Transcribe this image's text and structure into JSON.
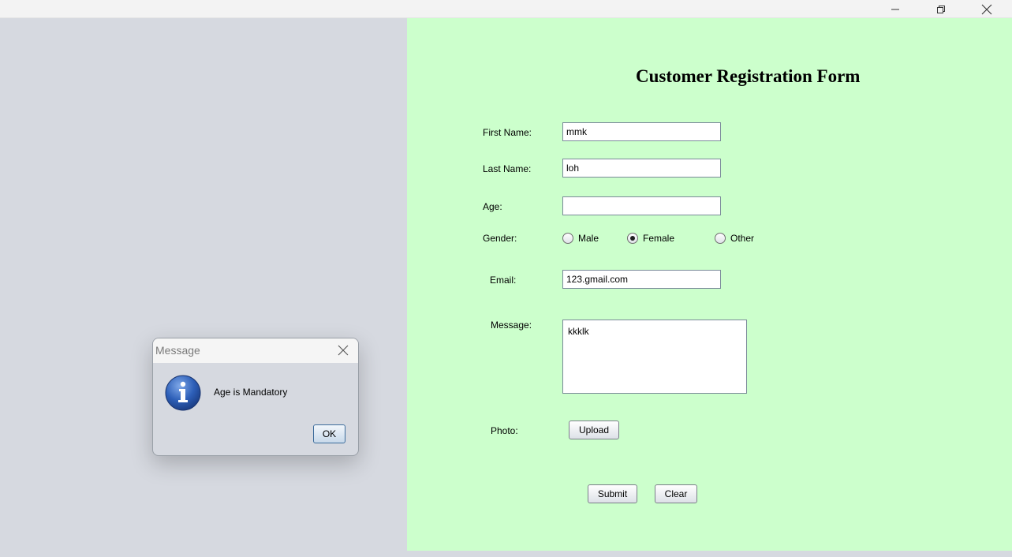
{
  "window": {
    "minimize_icon": "minimize-icon",
    "restore_icon": "restore-icon",
    "close_icon": "close-icon"
  },
  "form": {
    "title": "Customer Registration Form",
    "first_name": {
      "label": "First Name:",
      "value": "mmk"
    },
    "last_name": {
      "label": "Last Name:",
      "value": "loh"
    },
    "age": {
      "label": "Age:",
      "value": ""
    },
    "gender": {
      "label": "Gender:",
      "options": [
        "Male",
        "Female",
        "Other"
      ],
      "selected": "Female"
    },
    "email": {
      "label": "Email:",
      "value": "123.gmail.com"
    },
    "message": {
      "label": "Message:",
      "value": "kkklk"
    },
    "photo": {
      "label": "Photo:",
      "upload_label": "Upload"
    },
    "submit_label": "Submit",
    "clear_label": "Clear"
  },
  "dialog": {
    "title": "Message",
    "text": "Age is Mandatory",
    "ok_label": "OK",
    "icon": "info-icon"
  },
  "colors": {
    "form_background": "#ccffcc",
    "app_background": "#d6d9e0"
  }
}
